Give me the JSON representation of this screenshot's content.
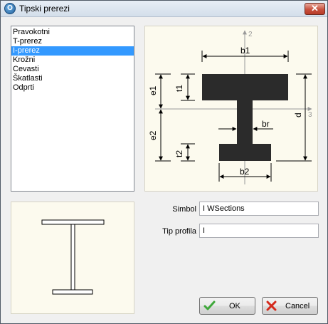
{
  "window": {
    "title": "Tipski prerezi",
    "app_icon": "app-logo-icon"
  },
  "section_types": {
    "items": [
      "Pravokotni",
      "T-prerez",
      "I-prerez",
      "Krožni",
      "Cevasti",
      "Škatlasti",
      "Odprti"
    ],
    "selected_index": 2
  },
  "diagram": {
    "axis_y_label": "2",
    "axis_x_label": "3",
    "dim_b1": "b1",
    "dim_b2": "b2",
    "dim_e1": "e1",
    "dim_e2": "e2",
    "dim_t1": "t1",
    "dim_t2": "t2",
    "dim_br": "br",
    "dim_d": "d"
  },
  "form": {
    "symbol_label": "Simbol",
    "symbol_value": "I WSections",
    "profile_type_label": "Tip profila",
    "profile_type_value": "I"
  },
  "buttons": {
    "ok_label": "OK",
    "cancel_label": "Cancel",
    "close_glyph": "✕"
  },
  "colors": {
    "selection": "#3399ff",
    "panel_background": "#fcfaee",
    "section_fill": "#2b2b2b"
  }
}
